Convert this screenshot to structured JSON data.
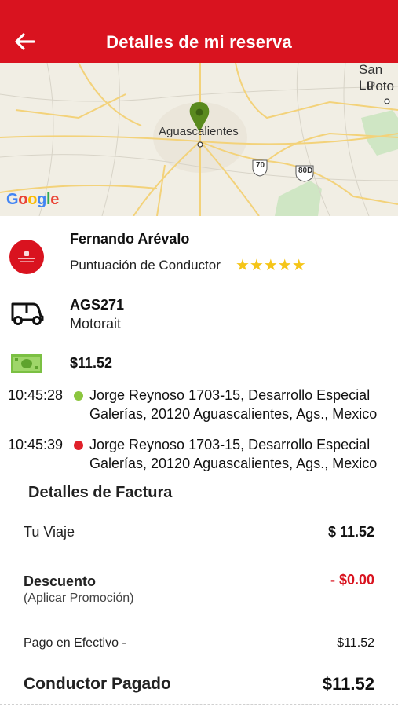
{
  "header": {
    "title": "Detalles de mi reserva",
    "back_icon": "arrow-left-icon",
    "background": "#d9131f"
  },
  "map": {
    "city_label": "Aguascalientes",
    "corner_label_top": "San Lu",
    "corner_label_bottom": "Poto",
    "highway_1": "70",
    "highway_2": "80D",
    "attribution": "Google",
    "pin_color": "#5a8a1e"
  },
  "driver": {
    "name": "Fernando Arévalo",
    "rating_label": "Puntuación de Conductor",
    "rating_stars": "★★★★★",
    "rating_value": 5
  },
  "vehicle": {
    "plate": "AGS271",
    "type": "Motorait"
  },
  "fare": {
    "amount": "$11.52"
  },
  "stops": [
    {
      "time": "10:45:28",
      "color": "#8cc63f",
      "address": "Jorge Reynoso 1703-15, Desarrollo Especial Galerías, 20120 Aguascalientes, Ags., Mexico"
    },
    {
      "time": "10:45:39",
      "color": "#e0202a",
      "address": "Jorge Reynoso 1703-15, Desarrollo Especial Galerías, 20120 Aguascalientes, Ags., Mexico"
    }
  ],
  "invoice": {
    "title": "Detalles de Factura",
    "trip_label": "Tu Viaje",
    "trip_value": "$ 11.52",
    "discount_label": "Descuento",
    "discount_value": "- $0.00",
    "promo_label": "(Aplicar Promoción)",
    "cash_label": "Pago en Efectivo -",
    "cash_value": "$11.52",
    "paid_label": "Conductor Pagado",
    "paid_value": "$11.52"
  }
}
